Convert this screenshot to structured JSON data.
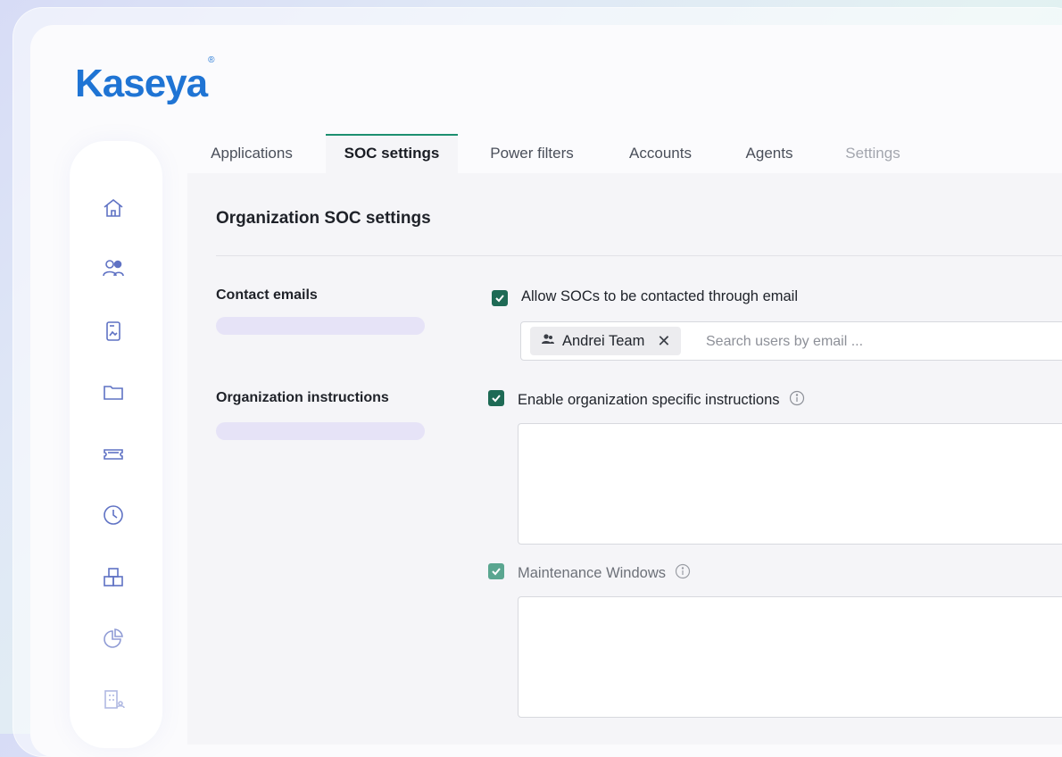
{
  "brand": {
    "logo": "Kaseya",
    "registered": "®"
  },
  "tabs": [
    {
      "label": "Applications"
    },
    {
      "label": "SOC settings"
    },
    {
      "label": "Power filters"
    },
    {
      "label": "Accounts"
    },
    {
      "label": "Agents"
    },
    {
      "label": "Settings"
    }
  ],
  "active_tab": "SOC settings",
  "sidebar": {
    "icons": [
      "home-icon",
      "users-icon",
      "document-icon",
      "folder-icon",
      "ticket-icon",
      "clock-icon",
      "boxes-icon",
      "pie-chart-icon",
      "building-icon"
    ]
  },
  "page": {
    "title": "Organization SOC settings",
    "contact": {
      "label": "Contact emails",
      "checkbox_label": "Allow SOCs to be contacted through email",
      "checked": true,
      "chip": "Andrei Team",
      "search_placeholder": "Search users by email ..."
    },
    "instructions": {
      "label": "Organization instructions",
      "checkbox_label": "Enable organization specific instructions",
      "checked": true,
      "maintenance_label": "Maintenance Windows",
      "maintenance_checked": true
    }
  },
  "colors": {
    "brand": "#1f74d4",
    "accent": "#1c8f70",
    "checkbox": "#1e6a55"
  }
}
